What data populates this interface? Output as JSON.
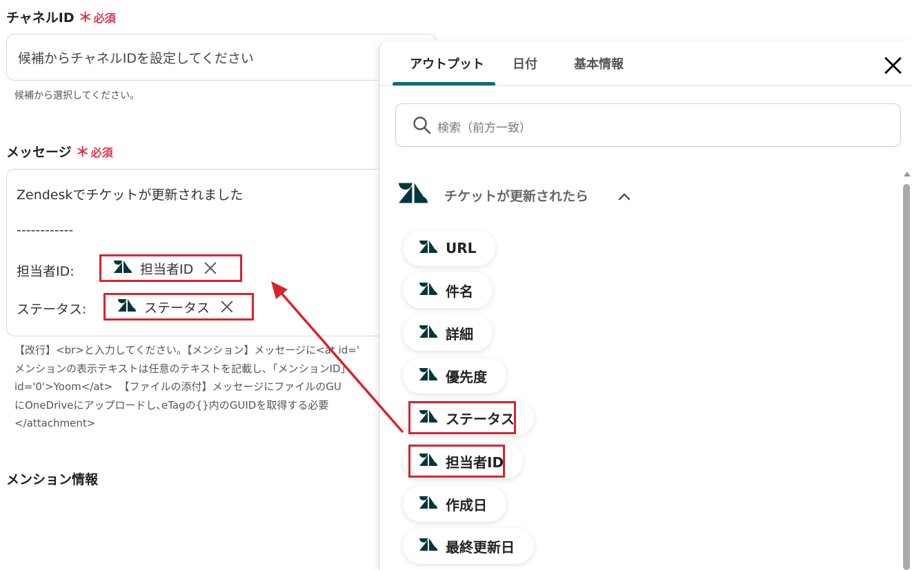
{
  "form": {
    "channel": {
      "label": "チャネルID",
      "required_star": "＊",
      "required_text": "必須",
      "placeholder": "候補からチャネルIDを設定してください",
      "hint": "候補から選択してください。"
    },
    "message": {
      "label": "メッセージ",
      "required_star": "＊",
      "required_text": "必須",
      "line1": "Zendeskでチケットが更新されました",
      "line2": "------------",
      "assignee_prefix": "担当者ID:",
      "assignee_token": "担当者ID",
      "status_prefix": "ステータス:",
      "status_token": "ステータス",
      "help_lines": [
        "【改行】<br>と入力してください。【メンション】メッセージに<at id='",
        "メンションの表示テキストは任意のテキストを記載し､「メンションID」",
        "id='0'>Yoom</at>  【ファイルの添付】メッセージにファイルのGU",
        "にOneDriveにアップロードし､eTagの{}内のGUIDを取得する必要",
        "</attachment>"
      ]
    },
    "mention_heading": "メンション情報"
  },
  "panel": {
    "tabs": [
      "アウトプット",
      "日付",
      "基本情報"
    ],
    "active_tab": "アウトプット",
    "search_placeholder": "検索（前方一致）",
    "section_title": "チケットが更新されたら",
    "items": [
      "URL",
      "件名",
      "詳細",
      "優先度",
      "ステータス",
      "担当者ID",
      "作成日",
      "最終更新日"
    ],
    "highlighted_items": [
      "ステータス",
      "担当者ID"
    ]
  },
  "colors": {
    "required": "#e2354d",
    "highlight": "#d9232d",
    "tab_accent": "#0f6b7a",
    "zendesk": "#03363d"
  },
  "icons": {
    "zendesk": "zendesk-icon",
    "search": "search-icon",
    "close": "close-icon",
    "chevron": "chevron-up-icon"
  }
}
